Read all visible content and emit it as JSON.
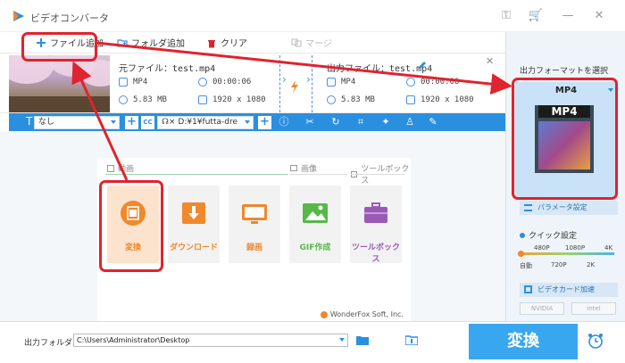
{
  "window": {
    "title": "ビデオコンバータ"
  },
  "toolbar": {
    "add_file": "ファイル追加",
    "add_folder": "フォルダ追加",
    "clear": "クリア",
    "merge": "マージ"
  },
  "file": {
    "source_label": "元ファイル：test.mp4",
    "output_label": "出力ファイル：test.mp4",
    "source": {
      "format": "MP4",
      "duration": "00:00:06",
      "size": "5.83 MB",
      "resolution": "1920 x 1080"
    },
    "output": {
      "format": "MP4",
      "duration": "00:00:06",
      "size": "5.83 MB",
      "resolution": "1920 x 1080"
    }
  },
  "editbar": {
    "subtitle_value": "なし",
    "audio_value": "☊× D:¥1¥futta-dre"
  },
  "sections": {
    "video": "動画",
    "image": "画像",
    "toolbox": "ツールボックス"
  },
  "cards": [
    {
      "label": "変換",
      "color": "#f0882c",
      "icon": "film-convert-icon"
    },
    {
      "label": "ダウンロード",
      "color": "#f0882c",
      "icon": "download-icon"
    },
    {
      "label": "録画",
      "color": "#f0882c",
      "icon": "screen-record-icon"
    },
    {
      "label": "GIF作成",
      "color": "#57b848",
      "icon": "image-icon"
    },
    {
      "label": "ツールボックス",
      "color": "#9b59b6",
      "icon": "toolbox-icon"
    }
  ],
  "brand": "WonderFox Soft, Inc.",
  "right_panel": {
    "title": "出力フォーマットを選択",
    "format": "MP4",
    "icon_text": "MP4",
    "param_button": "パラメータ設定",
    "quick_label": "クイック設定",
    "quick_top": [
      "480P",
      "1080P",
      "4K"
    ],
    "quick_bottom": [
      "自動",
      "720P",
      "2K"
    ],
    "gpu_button": "ビデオカード加速",
    "chips": [
      "NVIDIA",
      "intel"
    ]
  },
  "bottom": {
    "output_folder_label": "出力フォルダ：",
    "output_path": "C:\\Users\\Administrator\\Desktop",
    "convert_button": "変換"
  },
  "colors": {
    "accent": "#2b8fe0",
    "convert": "#38a7f0",
    "annotation": "#e0232e"
  }
}
